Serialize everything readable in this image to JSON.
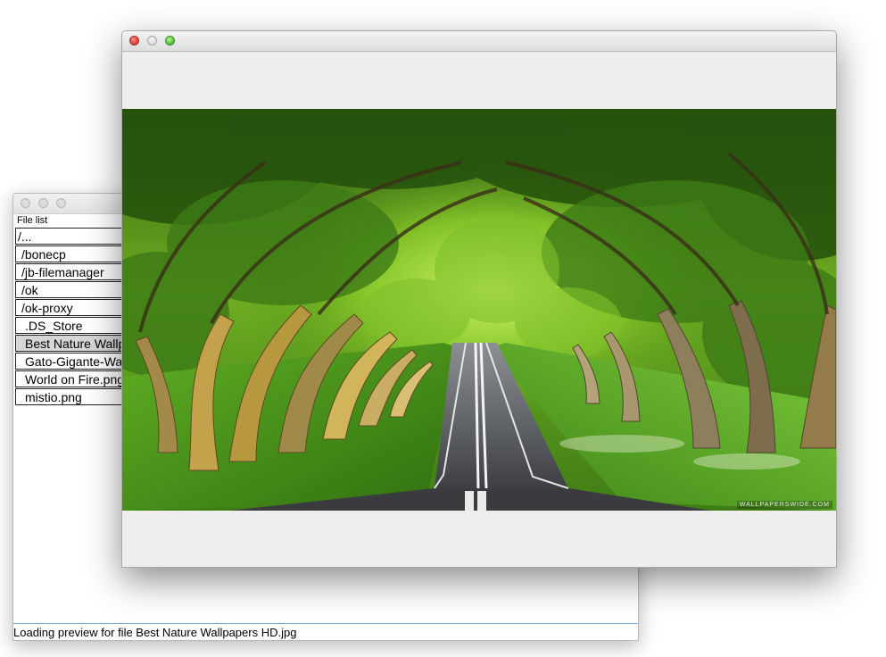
{
  "file_list": {
    "label": "File list",
    "items": [
      {
        "label": "/...",
        "selected": false,
        "indent": false
      },
      {
        "label": "/bonecp",
        "selected": false,
        "indent": true
      },
      {
        "label": "/jb-filemanager",
        "selected": false,
        "indent": true
      },
      {
        "label": "/ok",
        "selected": false,
        "indent": true
      },
      {
        "label": "/ok-proxy",
        "selected": false,
        "indent": true
      },
      {
        "label": ".DS_Store",
        "selected": false,
        "indent": true
      },
      {
        "label": "Best Nature Wallpapers HD.jpg",
        "selected": true,
        "indent": true
      },
      {
        "label": "Gato-Gigante-Wallpaper.jpg",
        "selected": false,
        "indent": true
      },
      {
        "label": "World on Fire.png",
        "selected": false,
        "indent": true
      },
      {
        "label": "mistio.png",
        "selected": false,
        "indent": true
      }
    ]
  },
  "status_bar": {
    "text": "Loading preview for file Best Nature Wallpapers HD.jpg"
  },
  "preview": {
    "watermark": "WALLPAPERSWIDE.COM"
  },
  "colors": {
    "close_light": "#e0443a",
    "zoom_light": "#5bc236",
    "selected_row": "#d6d6d6",
    "status_divider": "#7ea6cf"
  }
}
